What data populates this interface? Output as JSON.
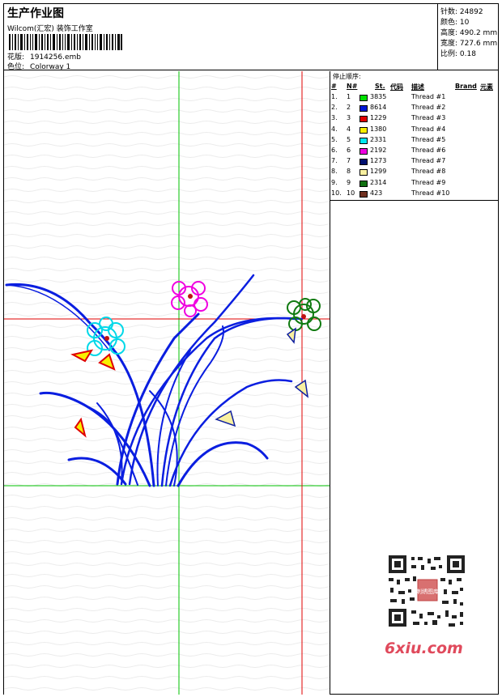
{
  "header": {
    "title": "生产作业图",
    "company": "Wilcom(汇宏) 装饰工作室",
    "design_label": "花版:",
    "design_value": "1914256.emb",
    "colorway_label": "色位:",
    "colorway_value": "Colorway 1"
  },
  "stats": {
    "stitches_label": "针数:",
    "stitches_value": "24892",
    "colors_label": "颜色:",
    "colors_value": "10",
    "height_label": "高度:",
    "height_value": "490.2 mm",
    "width_label": "宽度:",
    "width_value": "727.6 mm",
    "scale_label": "比例:",
    "scale_value": "0.18"
  },
  "sequence": {
    "title": "停止顺序:",
    "columns": [
      "#",
      "N#",
      "St.",
      "代码",
      "描述",
      "Brand",
      "元素"
    ],
    "rows": [
      {
        "idx": "1.",
        "n": "1",
        "color": "#00e000",
        "st": "3835",
        "desc": "Thread #1"
      },
      {
        "idx": "2.",
        "n": "2",
        "color": "#0018d8",
        "st": "8614",
        "desc": "Thread #2"
      },
      {
        "idx": "3.",
        "n": "3",
        "color": "#e00000",
        "st": "1229",
        "desc": "Thread #3"
      },
      {
        "idx": "4.",
        "n": "4",
        "color": "#f8f000",
        "st": "1380",
        "desc": "Thread #4"
      },
      {
        "idx": "5.",
        "n": "5",
        "color": "#00e8f0",
        "st": "2331",
        "desc": "Thread #5"
      },
      {
        "idx": "6.",
        "n": "6",
        "color": "#f000e0",
        "st": "2192",
        "desc": "Thread #6"
      },
      {
        "idx": "7.",
        "n": "7",
        "color": "#001070",
        "st": "1273",
        "desc": "Thread #7"
      },
      {
        "idx": "8.",
        "n": "8",
        "color": "#f8f0a0",
        "st": "1299",
        "desc": "Thread #8"
      },
      {
        "idx": "9.",
        "n": "9",
        "color": "#107010",
        "st": "2314",
        "desc": "Thread #9"
      },
      {
        "idx": "10.",
        "n": "10",
        "color": "#703020",
        "st": "423",
        "desc": "Thread #10"
      }
    ]
  },
  "watermark": {
    "site": "6xiu.com",
    "stamp": "刺绣图库"
  }
}
